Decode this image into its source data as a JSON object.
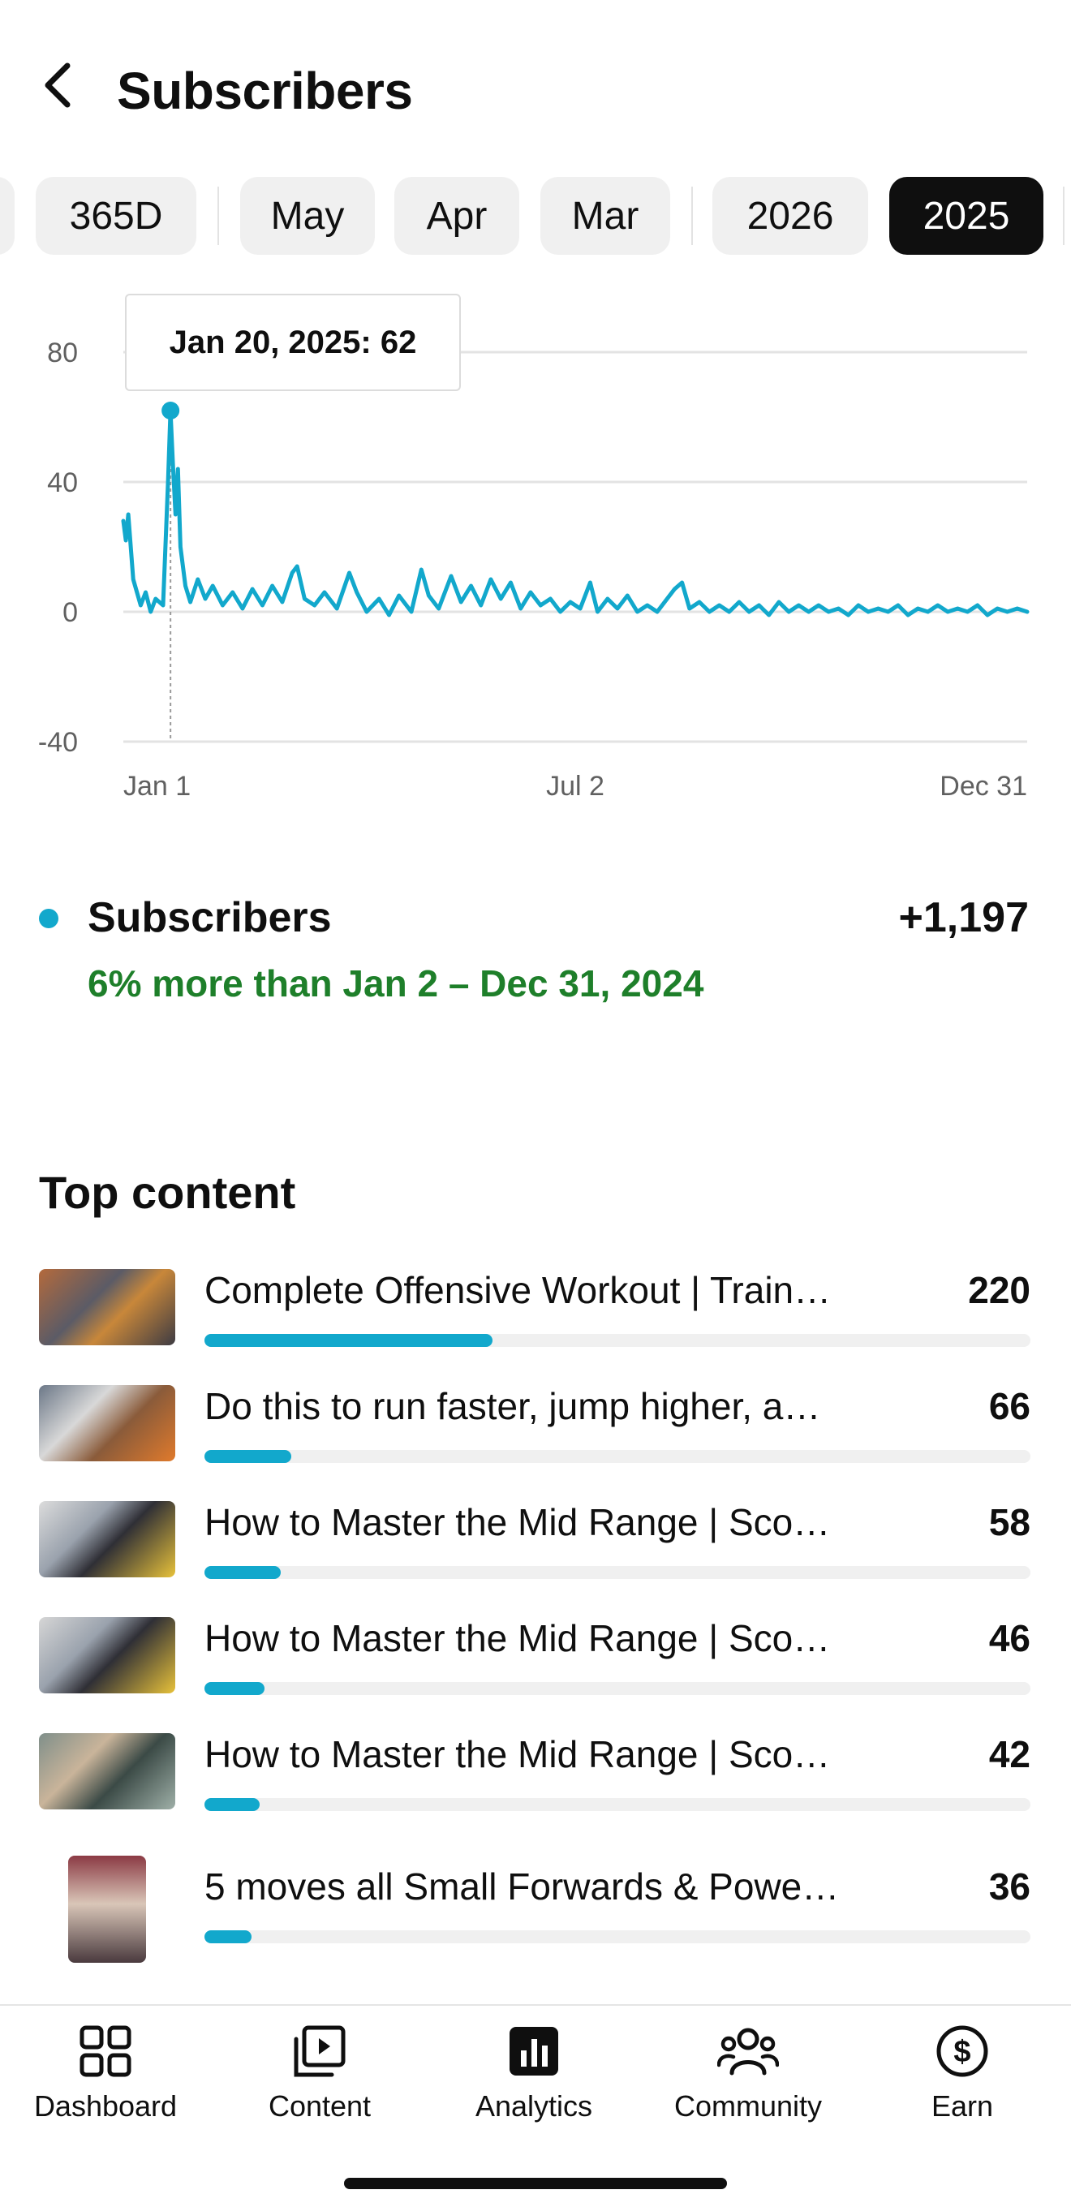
{
  "header": {
    "back_icon": "chevron-left-icon",
    "title": "Subscribers"
  },
  "filters": {
    "chips": [
      {
        "label": "365D",
        "selected": false
      },
      {
        "label": "May",
        "selected": false
      },
      {
        "label": "Apr",
        "selected": false
      },
      {
        "label": "Mar",
        "selected": false
      },
      {
        "label": "2026",
        "selected": false
      },
      {
        "label": "2025",
        "selected": true
      }
    ]
  },
  "chart": {
    "tooltip": "Jan 20, 2025: 62"
  },
  "chart_data": {
    "type": "line",
    "title": "",
    "xlabel": "",
    "ylabel": "",
    "x_ticks": [
      "Jan 1",
      "Jul 2",
      "Dec 31"
    ],
    "y_ticks": [
      "80",
      "40",
      "0",
      "-40"
    ],
    "ylim": [
      -40,
      80
    ],
    "grid": true,
    "series": [
      {
        "name": "Subscribers",
        "color": "#12a8cc",
        "points": [
          [
            "2025-01-01",
            28
          ],
          [
            "2025-01-02",
            22
          ],
          [
            "2025-01-03",
            30
          ],
          [
            "2025-01-05",
            10
          ],
          [
            "2025-01-08",
            2
          ],
          [
            "2025-01-10",
            6
          ],
          [
            "2025-01-12",
            0
          ],
          [
            "2025-01-14",
            4
          ],
          [
            "2025-01-17",
            2
          ],
          [
            "2025-01-19",
            40
          ],
          [
            "2025-01-20",
            62
          ],
          [
            "2025-01-21",
            45
          ],
          [
            "2025-01-22",
            30
          ],
          [
            "2025-01-23",
            44
          ],
          [
            "2025-01-24",
            20
          ],
          [
            "2025-01-26",
            8
          ],
          [
            "2025-01-28",
            3
          ],
          [
            "2025-01-31",
            10
          ],
          [
            "2025-02-03",
            4
          ],
          [
            "2025-02-06",
            8
          ],
          [
            "2025-02-10",
            2
          ],
          [
            "2025-02-14",
            6
          ],
          [
            "2025-02-18",
            1
          ],
          [
            "2025-02-22",
            7
          ],
          [
            "2025-02-26",
            2
          ],
          [
            "2025-03-02",
            8
          ],
          [
            "2025-03-06",
            3
          ],
          [
            "2025-03-10",
            12
          ],
          [
            "2025-03-12",
            14
          ],
          [
            "2025-03-15",
            4
          ],
          [
            "2025-03-19",
            2
          ],
          [
            "2025-03-23",
            6
          ],
          [
            "2025-03-28",
            1
          ],
          [
            "2025-04-02",
            12
          ],
          [
            "2025-04-05",
            6
          ],
          [
            "2025-04-09",
            0
          ],
          [
            "2025-04-14",
            4
          ],
          [
            "2025-04-18",
            -1
          ],
          [
            "2025-04-22",
            5
          ],
          [
            "2025-04-27",
            0
          ],
          [
            "2025-05-01",
            13
          ],
          [
            "2025-05-04",
            5
          ],
          [
            "2025-05-08",
            1
          ],
          [
            "2025-05-13",
            11
          ],
          [
            "2025-05-17",
            3
          ],
          [
            "2025-05-21",
            8
          ],
          [
            "2025-05-25",
            2
          ],
          [
            "2025-05-29",
            10
          ],
          [
            "2025-06-02",
            4
          ],
          [
            "2025-06-06",
            9
          ],
          [
            "2025-06-10",
            1
          ],
          [
            "2025-06-14",
            6
          ],
          [
            "2025-06-18",
            2
          ],
          [
            "2025-06-22",
            4
          ],
          [
            "2025-06-26",
            0
          ],
          [
            "2025-06-30",
            3
          ],
          [
            "2025-07-04",
            1
          ],
          [
            "2025-07-08",
            9
          ],
          [
            "2025-07-11",
            0
          ],
          [
            "2025-07-15",
            4
          ],
          [
            "2025-07-19",
            1
          ],
          [
            "2025-07-23",
            5
          ],
          [
            "2025-07-27",
            0
          ],
          [
            "2025-07-31",
            2
          ],
          [
            "2025-08-04",
            0
          ],
          [
            "2025-08-08",
            4
          ],
          [
            "2025-08-11",
            7
          ],
          [
            "2025-08-14",
            9
          ],
          [
            "2025-08-17",
            1
          ],
          [
            "2025-08-21",
            3
          ],
          [
            "2025-08-25",
            0
          ],
          [
            "2025-08-29",
            2
          ],
          [
            "2025-09-02",
            0
          ],
          [
            "2025-09-06",
            3
          ],
          [
            "2025-09-10",
            0
          ],
          [
            "2025-09-14",
            2
          ],
          [
            "2025-09-18",
            -1
          ],
          [
            "2025-09-22",
            3
          ],
          [
            "2025-09-26",
            0
          ],
          [
            "2025-09-30",
            2
          ],
          [
            "2025-10-04",
            0
          ],
          [
            "2025-10-08",
            2
          ],
          [
            "2025-10-12",
            0
          ],
          [
            "2025-10-16",
            1
          ],
          [
            "2025-10-20",
            -1
          ],
          [
            "2025-10-24",
            2
          ],
          [
            "2025-10-28",
            0
          ],
          [
            "2025-11-01",
            1
          ],
          [
            "2025-11-05",
            0
          ],
          [
            "2025-11-09",
            2
          ],
          [
            "2025-11-13",
            -1
          ],
          [
            "2025-11-17",
            1
          ],
          [
            "2025-11-21",
            0
          ],
          [
            "2025-11-25",
            2
          ],
          [
            "2025-11-29",
            0
          ],
          [
            "2025-12-03",
            1
          ],
          [
            "2025-12-07",
            0
          ],
          [
            "2025-12-11",
            2
          ],
          [
            "2025-12-15",
            -1
          ],
          [
            "2025-12-19",
            1
          ],
          [
            "2025-12-23",
            0
          ],
          [
            "2025-12-27",
            1
          ],
          [
            "2025-12-31",
            0
          ]
        ]
      }
    ],
    "highlight": {
      "x": "2025-01-20",
      "y": 62
    }
  },
  "summary": {
    "metric_label": "Subscribers",
    "metric_value": "+1,197",
    "comparison": "6% more than Jan 2 – Dec 31, 2024"
  },
  "top_content": {
    "title": "Top content",
    "items": [
      {
        "title": "Complete Offensive Workout | Train…",
        "count": "220",
        "value": 220,
        "thumb": "landscape"
      },
      {
        "title": "Do this to run faster, jump higher, a…",
        "count": "66",
        "value": 66,
        "thumb": "landscape"
      },
      {
        "title": "How to Master the Mid Range | Sco…",
        "count": "58",
        "value": 58,
        "thumb": "landscape"
      },
      {
        "title": "How to Master the Mid Range | Sco…",
        "count": "46",
        "value": 46,
        "thumb": "landscape"
      },
      {
        "title": "How to Master the Mid Range | Sco…",
        "count": "42",
        "value": 42,
        "thumb": "landscape"
      },
      {
        "title": "5 moves all Small Forwards & Powe…",
        "count": "36",
        "value": 36,
        "thumb": "portrait"
      }
    ]
  },
  "bottom_nav": {
    "items": [
      {
        "label": "Dashboard",
        "icon": "dashboard-icon"
      },
      {
        "label": "Content",
        "icon": "content-icon"
      },
      {
        "label": "Analytics",
        "icon": "analytics-icon"
      },
      {
        "label": "Community",
        "icon": "community-icon"
      },
      {
        "label": "Earn",
        "icon": "earn-icon"
      }
    ]
  },
  "colors": {
    "accent": "#12a8cc",
    "positive": "#1e7f2a",
    "chip_bg": "#f0f0f0",
    "chip_selected_bg": "#0f0f0f"
  }
}
